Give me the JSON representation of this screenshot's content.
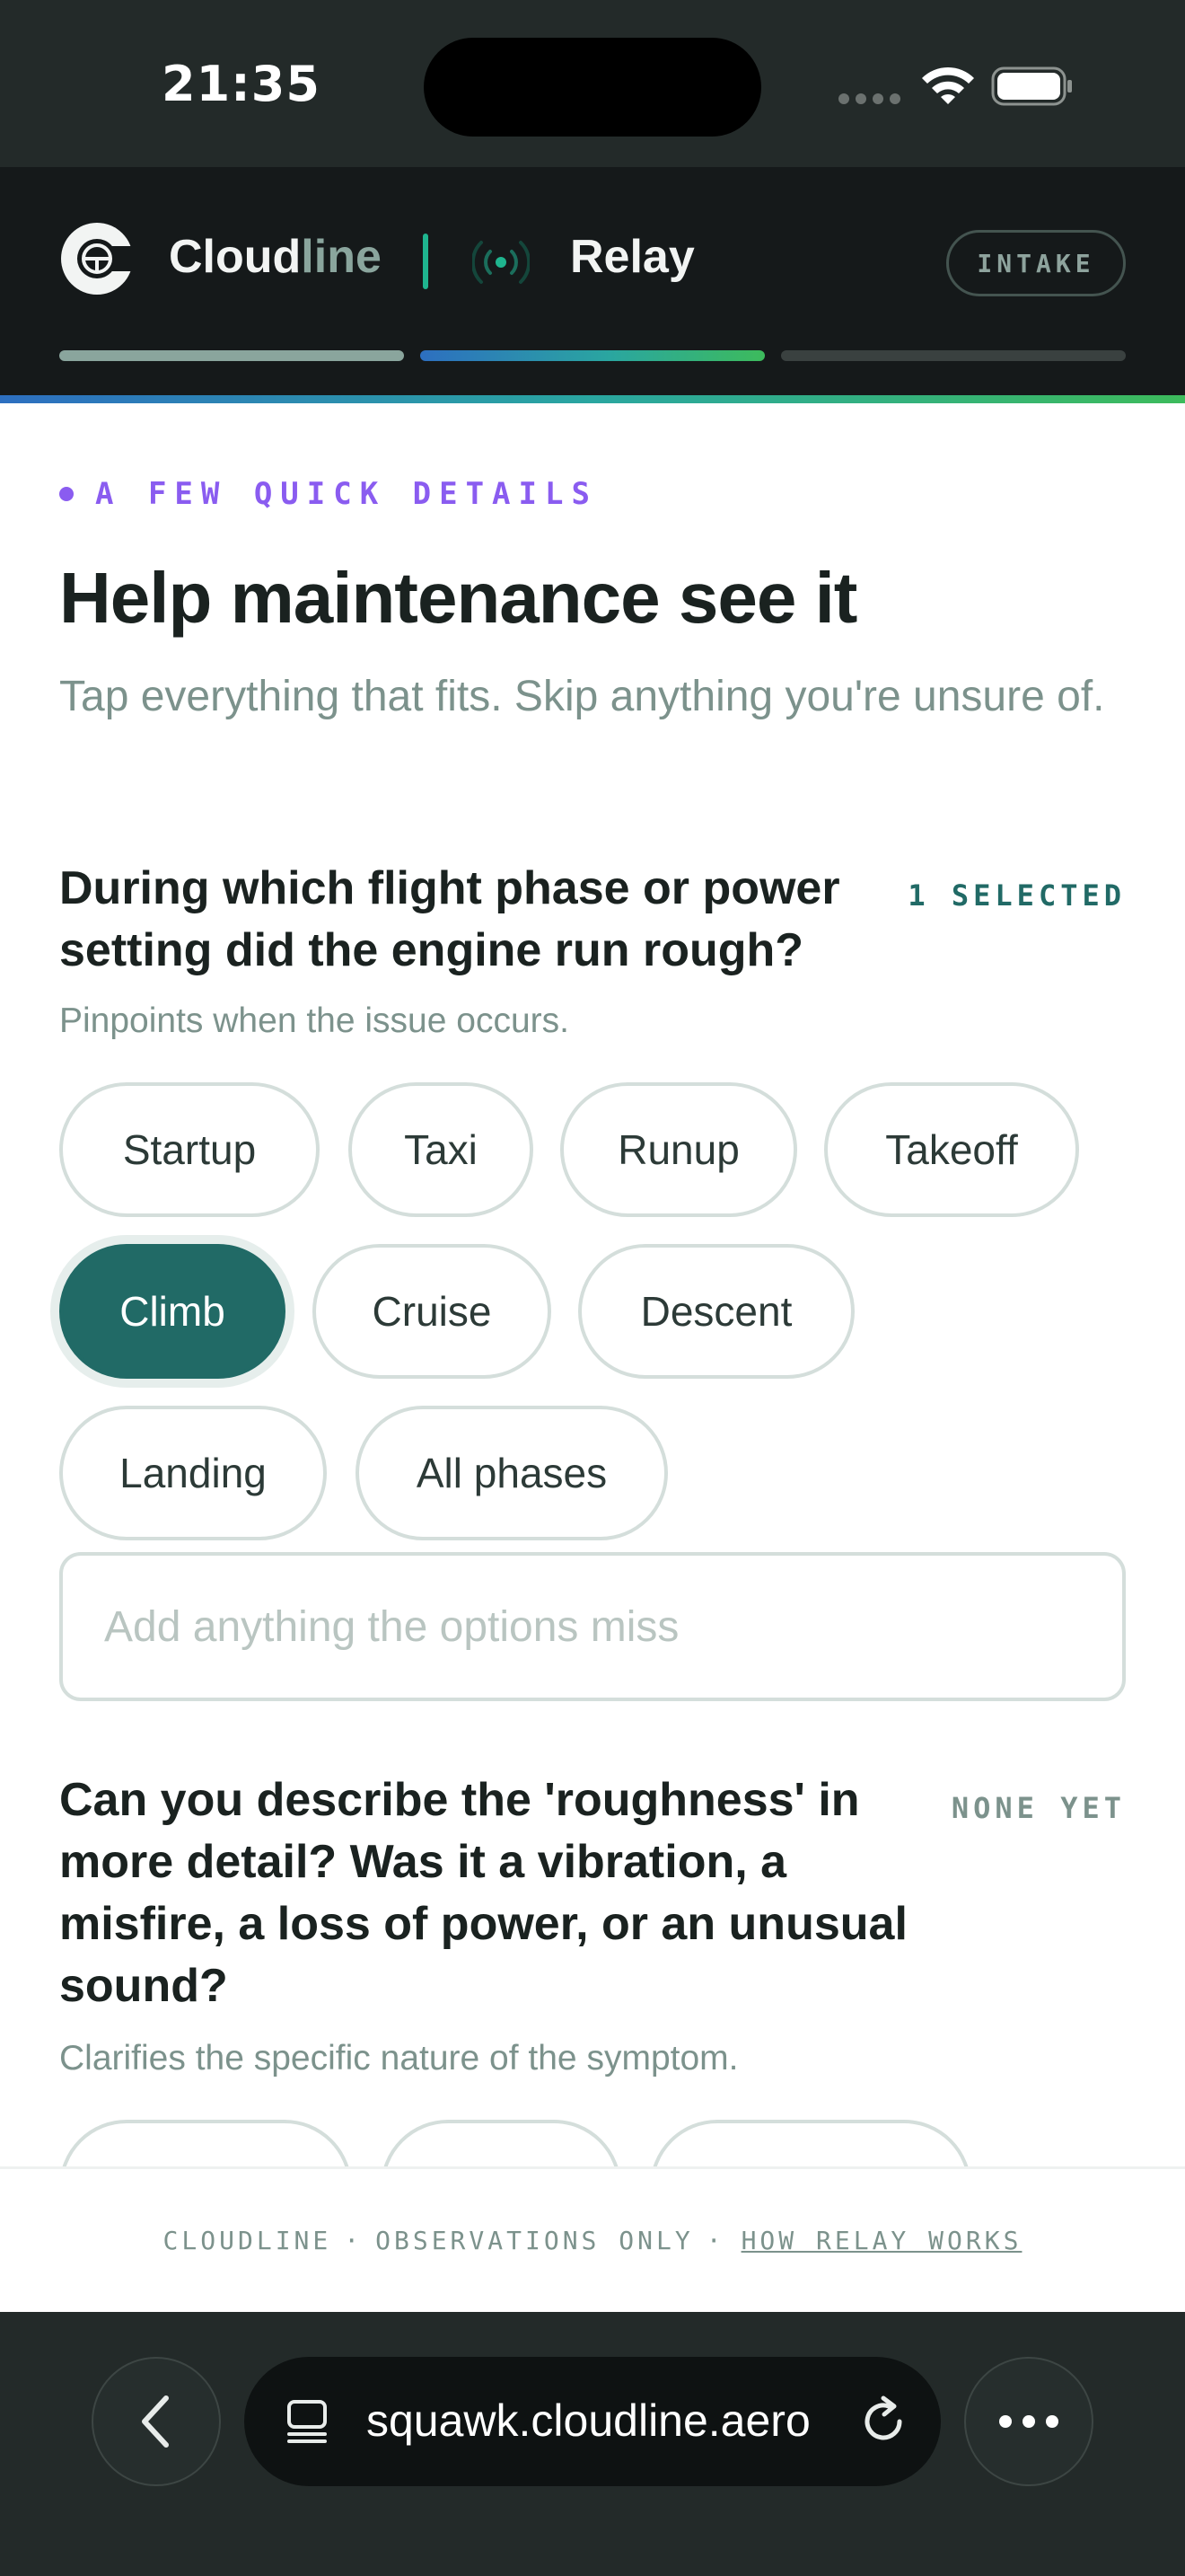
{
  "status_bar": {
    "time": "21:35"
  },
  "header": {
    "brand_main": "Cloud",
    "brand_accent": "line",
    "product": "Relay",
    "intake_label": "INTAKE",
    "progress_steps": [
      {
        "color": "#8aa59d"
      },
      {
        "color": "gradient-blue-green"
      },
      {
        "color": "#3a4140"
      }
    ]
  },
  "content": {
    "eyebrow": "A FEW QUICK DETAILS",
    "title": "Help maintenance see it",
    "lede": "Tap everything that fits. Skip anything you're unsure of.",
    "questions": [
      {
        "title": "During which flight phase or power setting did the engine run rough?",
        "count": "1 SELECTED",
        "help": "Pinpoints when the issue occurs.",
        "options": [
          "Startup",
          "Taxi",
          "Runup",
          "Takeoff",
          "Climb",
          "Cruise",
          "Descent",
          "Landing",
          "All phases"
        ],
        "selected": [
          "Climb"
        ],
        "other_placeholder": "Add anything the options miss"
      },
      {
        "title": "Can you describe the 'roughness' in more detail? Was it a vibration, a misfire, a loss of power, or an unusual sound?",
        "count": "NONE YET",
        "help": "Clarifies the specific nature of the symptom."
      }
    ]
  },
  "footer": {
    "brand": "CLOUDLINE",
    "sep": "·",
    "note": "OBSERVATIONS ONLY",
    "link": "HOW RELAY WORKS"
  },
  "browser": {
    "url": "squawk.cloudline.aero"
  },
  "colors": {
    "accent_teal": "#216a66",
    "eyebrow_purple": "#8a5cf0",
    "header_bg": "#15191a"
  }
}
